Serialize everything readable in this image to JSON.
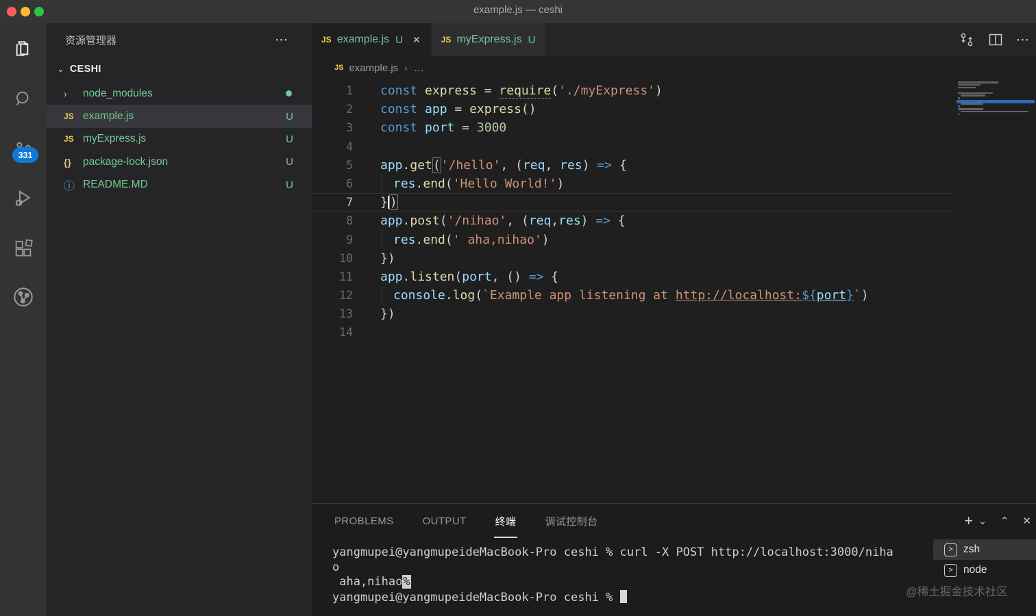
{
  "window": {
    "title": "example.js — ceshi"
  },
  "activity_bar": {
    "badge": "331",
    "icons": [
      "explorer",
      "search",
      "source-control",
      "run-debug",
      "extensions",
      "git-circle"
    ]
  },
  "sidebar": {
    "title": "资源管理器",
    "more": "⋯",
    "section_chevron": "⌄",
    "section": "CESHI",
    "files": [
      {
        "name": "node_modules",
        "icon": "chevron",
        "badge": "dot",
        "selected": false
      },
      {
        "name": "example.js",
        "icon": "js",
        "badge": "U",
        "selected": true
      },
      {
        "name": "myExpress.js",
        "icon": "js",
        "badge": "U",
        "selected": false
      },
      {
        "name": "package-lock.json",
        "icon": "json",
        "badge": "U",
        "selected": false
      },
      {
        "name": "README.MD",
        "icon": "info",
        "badge": "U",
        "selected": false
      }
    ]
  },
  "tabs": [
    {
      "label": "example.js",
      "dirty": "U",
      "close": "✕",
      "active": true
    },
    {
      "label": "myExpress.js",
      "dirty": "U",
      "active": false
    }
  ],
  "breadcrumb": {
    "file": "example.js",
    "separator": "›",
    "more": "…"
  },
  "editor": {
    "language_badge": "JS",
    "active_line": 7,
    "lines": [
      {
        "n": 1,
        "tokens": [
          [
            "kw",
            "const "
          ],
          [
            "fn",
            "express"
          ],
          [
            "p",
            " = "
          ],
          [
            "req",
            "require"
          ],
          [
            "p",
            "("
          ],
          [
            "str",
            "'./myExpress'"
          ],
          [
            "p",
            ")"
          ]
        ]
      },
      {
        "n": 2,
        "tokens": [
          [
            "kw",
            "const "
          ],
          [
            "vr",
            "app"
          ],
          [
            "p",
            " = "
          ],
          [
            "fn",
            "express"
          ],
          [
            "p",
            "()"
          ]
        ]
      },
      {
        "n": 3,
        "tokens": [
          [
            "kw",
            "const "
          ],
          [
            "vr",
            "port"
          ],
          [
            "p",
            " = "
          ],
          [
            "num",
            "3000"
          ]
        ]
      },
      {
        "n": 4,
        "tokens": []
      },
      {
        "n": 5,
        "tokens": [
          [
            "vr",
            "app"
          ],
          [
            "p",
            "."
          ],
          [
            "fn",
            "get"
          ],
          [
            "brk",
            "("
          ],
          [
            "str",
            "'/hello'"
          ],
          [
            "p",
            ", ("
          ],
          [
            "vr",
            "req"
          ],
          [
            "p",
            ", "
          ],
          [
            "vr",
            "res"
          ],
          [
            "p",
            ") "
          ],
          [
            "kw",
            "=>"
          ],
          [
            "p",
            " {"
          ]
        ]
      },
      {
        "n": 6,
        "ind": true,
        "tokens": [
          [
            "vr",
            "res"
          ],
          [
            "p",
            "."
          ],
          [
            "fn",
            "end"
          ],
          [
            "p",
            "("
          ],
          [
            "str",
            "'Hello World!'"
          ],
          [
            "p",
            ")"
          ]
        ]
      },
      {
        "n": 7,
        "tokens": [
          [
            "p",
            "}"
          ],
          [
            "cursor",
            ""
          ],
          [
            "brk",
            ")"
          ]
        ]
      },
      {
        "n": 8,
        "tokens": [
          [
            "vr",
            "app"
          ],
          [
            "p",
            "."
          ],
          [
            "fn",
            "post"
          ],
          [
            "p",
            "("
          ],
          [
            "str",
            "'/nihao'"
          ],
          [
            "p",
            ", ("
          ],
          [
            "vr",
            "req"
          ],
          [
            "p",
            ","
          ],
          [
            "vr",
            "res"
          ],
          [
            "p",
            ") "
          ],
          [
            "kw",
            "=>"
          ],
          [
            "p",
            " {"
          ]
        ]
      },
      {
        "n": 9,
        "ind": true,
        "tokens": [
          [
            "vr",
            "res"
          ],
          [
            "p",
            "."
          ],
          [
            "fn",
            "end"
          ],
          [
            "p",
            "("
          ],
          [
            "str",
            "' aha,nihao'"
          ],
          [
            "p",
            ")"
          ]
        ]
      },
      {
        "n": 10,
        "tokens": [
          [
            "p",
            "})"
          ]
        ]
      },
      {
        "n": 11,
        "tokens": [
          [
            "vr",
            "app"
          ],
          [
            "p",
            "."
          ],
          [
            "fn",
            "listen"
          ],
          [
            "p",
            "("
          ],
          [
            "vr",
            "port"
          ],
          [
            "p",
            ", () "
          ],
          [
            "kw",
            "=>"
          ],
          [
            "p",
            " {"
          ]
        ]
      },
      {
        "n": 12,
        "ind": true,
        "tokens": [
          [
            "vr",
            "console"
          ],
          [
            "p",
            "."
          ],
          [
            "fn",
            "log"
          ],
          [
            "p",
            "("
          ],
          [
            "str",
            "`Example app listening at "
          ],
          [
            "lnk",
            "http://localhost:"
          ],
          [
            "tmu",
            "${"
          ],
          [
            "vru",
            "port"
          ],
          [
            "tmu",
            "}"
          ],
          [
            "str",
            "`"
          ],
          [
            "p",
            ")"
          ]
        ]
      },
      {
        "n": 13,
        "tokens": [
          [
            "p",
            "})"
          ]
        ]
      },
      {
        "n": 14,
        "tokens": []
      }
    ]
  },
  "minimap": {
    "highlight_line": 8
  },
  "panel": {
    "tabs": [
      {
        "label": "PROBLEMS",
        "active": false
      },
      {
        "label": "OUTPUT",
        "active": false
      },
      {
        "label": "终端",
        "active": true
      },
      {
        "label": "调试控制台",
        "active": false
      }
    ],
    "actions": {
      "new": "+",
      "dropdown": "⌄",
      "maximize": "⌃",
      "close": "✕"
    },
    "terminal": {
      "lines": [
        [
          [
            "t",
            "yangmupei@yangmupeideMacBook-Pro ceshi % curl -X POST http://localhost:3000/niha"
          ]
        ],
        [
          [
            "t",
            "o"
          ]
        ],
        [
          [
            "t",
            " aha,nihao"
          ],
          [
            "rev",
            "%"
          ]
        ],
        [
          [
            "t",
            "yangmupei@yangmupeideMacBook-Pro ceshi % "
          ],
          [
            "cur",
            " "
          ]
        ]
      ],
      "list": [
        {
          "label": "zsh",
          "selected": true
        },
        {
          "label": "node",
          "selected": false
        }
      ]
    }
  },
  "watermark": "@稀土掘金技术社区",
  "colors": {
    "keyword_blue": "#569cd6",
    "variable_blue": "#9cdcfe",
    "function_yellow": "#dcdcaa",
    "string_orange": "#ce9178",
    "number_green": "#b5cea8",
    "git_green": "#73c991",
    "badge_blue": "#1177d7",
    "traffic_red": "#ff5f57",
    "traffic_yellow": "#febc2e",
    "traffic_green": "#28c840",
    "editor_bg": "#1f1f1f",
    "sidebar_bg": "#252528",
    "activitybar_bg": "#333334",
    "titlebar_bg": "#353536"
  }
}
